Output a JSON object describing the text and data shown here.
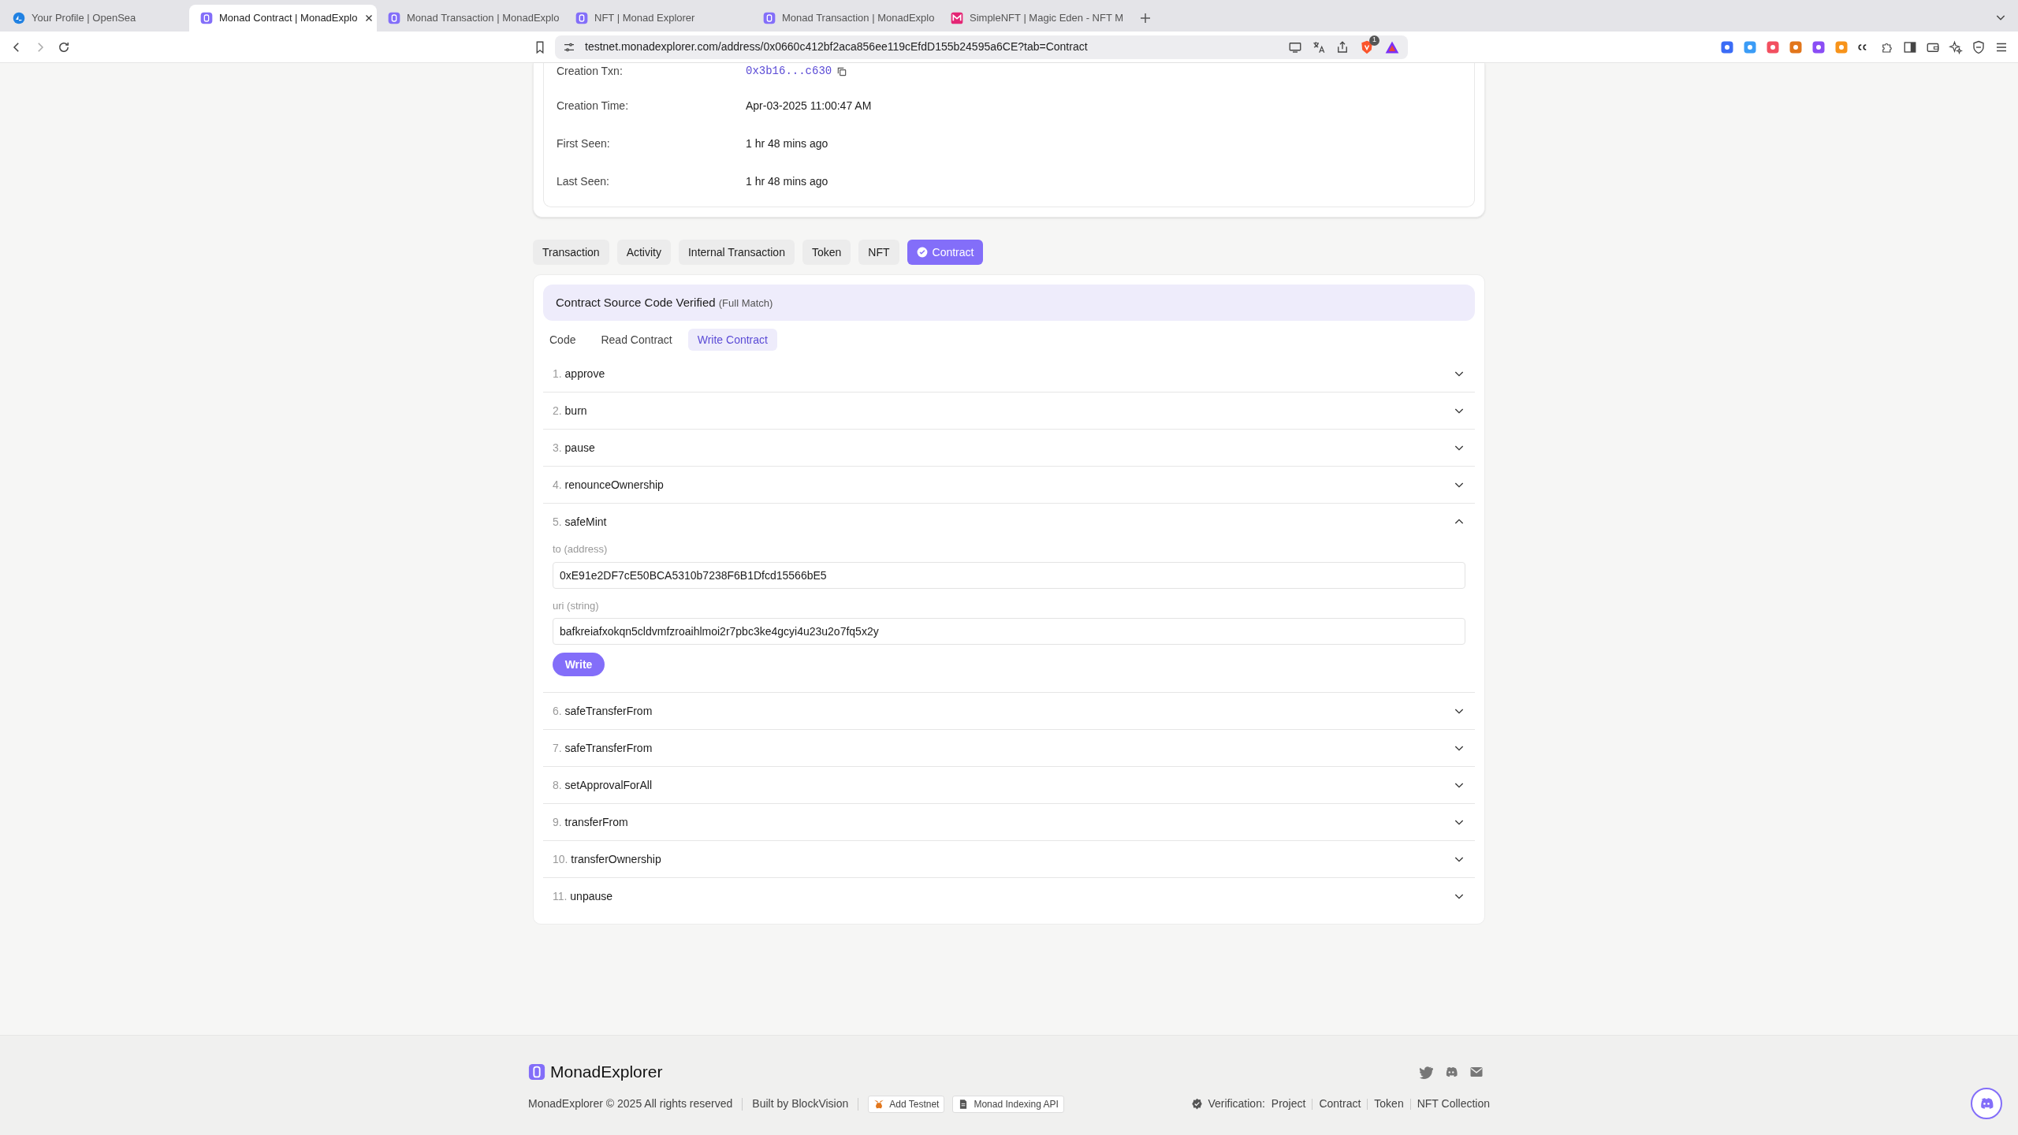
{
  "browser": {
    "tabs": [
      {
        "title": "Your Profile | OpenSea",
        "selected": false,
        "kind": "wave"
      },
      {
        "title": "Monad Contract | MonadExplo",
        "selected": true,
        "kind": "pill"
      },
      {
        "title": "Monad Transaction | MonadExplo",
        "selected": false,
        "kind": "pill"
      },
      {
        "title": "NFT | Monad Explorer",
        "selected": false,
        "kind": "pill"
      },
      {
        "title": "Monad Transaction | MonadExplo",
        "selected": false,
        "kind": "pill"
      },
      {
        "title": "SimpleNFT | Magic Eden - NFT M",
        "selected": false,
        "kind": "letter"
      }
    ],
    "address": "testnet.monadexplorer.com/address/0x0660c412bf2aca856ee119cEfdD155b24595a6CE?tab=Contract",
    "shield_count": "1"
  },
  "details": [
    {
      "label": "Creation Txn:",
      "value": "0x3b16...c630",
      "kind": "link"
    },
    {
      "label": "Creation Time:",
      "value": "Apr-03-2025 11:00:47 AM",
      "kind": "text"
    },
    {
      "label": "First Seen:",
      "value": "1 hr 48 mins ago",
      "kind": "text"
    },
    {
      "label": "Last Seen:",
      "value": "1 hr 48 mins ago",
      "kind": "text"
    }
  ],
  "page_tabs": [
    {
      "label": "Transaction",
      "selected": false
    },
    {
      "label": "Activity",
      "selected": false
    },
    {
      "label": "Internal Transaction",
      "selected": false
    },
    {
      "label": "Token",
      "selected": false
    },
    {
      "label": "NFT",
      "selected": false
    },
    {
      "label": "Contract",
      "selected": true
    }
  ],
  "contract": {
    "banner": "Contract Source Code Verified",
    "banner_note": "(Full Match)",
    "subtabs": [
      {
        "label": "Code",
        "selected": false
      },
      {
        "label": "Read Contract",
        "selected": false
      },
      {
        "label": "Write Contract",
        "selected": true
      }
    ],
    "functions": [
      {
        "index": "1.",
        "name": "approve",
        "expanded": false
      },
      {
        "index": "2.",
        "name": "burn",
        "expanded": false
      },
      {
        "index": "3.",
        "name": "pause",
        "expanded": false
      },
      {
        "index": "4.",
        "name": "renounceOwnership",
        "expanded": false
      },
      {
        "index": "5.",
        "name": "safeMint",
        "expanded": true,
        "inputs": [
          {
            "label": "to (address)",
            "value": "0xE91e2DF7cE50BCA5310b7238F6B1Dfcd15566bE5"
          },
          {
            "label": "uri (string)",
            "value": "bafkreiafxokqn5cldvmfzroaihlmoi2r7pbc3ke4gcyi4u23u2o7fq5x2y"
          }
        ],
        "button": "Write"
      },
      {
        "index": "6.",
        "name": "safeTransferFrom",
        "expanded": false
      },
      {
        "index": "7.",
        "name": "safeTransferFrom",
        "expanded": false
      },
      {
        "index": "8.",
        "name": "setApprovalForAll",
        "expanded": false
      },
      {
        "index": "9.",
        "name": "transferFrom",
        "expanded": false
      },
      {
        "index": "10.",
        "name": "transferOwnership",
        "expanded": false
      },
      {
        "index": "11.",
        "name": "unpause",
        "expanded": false
      }
    ]
  },
  "footer": {
    "brand": "MonadExplorer",
    "copyright": "MonadExplorer © 2025 All rights reserved",
    "built_by": "Built by BlockVision",
    "add_testnet": "Add Testnet",
    "indexing_api": "Monad Indexing API",
    "verification_label": "Verification:",
    "verification_links": [
      "Project",
      "Contract",
      "Token",
      "NFT Collection"
    ]
  }
}
